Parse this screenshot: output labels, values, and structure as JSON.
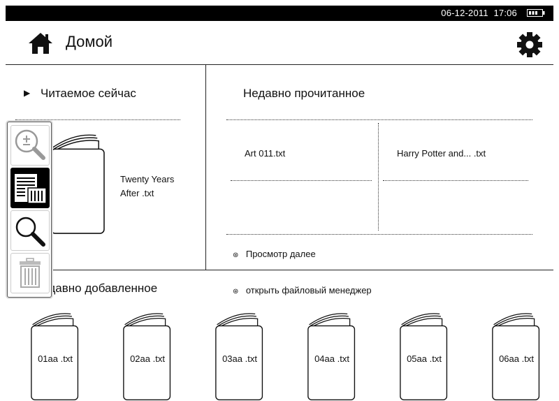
{
  "status": {
    "date": "06-12-2011",
    "time": "17:06"
  },
  "header": {
    "title": "Домой"
  },
  "reading_now": {
    "heading": "Читаемое сейчас",
    "book_line1": "Twenty Years",
    "book_line2": "After .txt"
  },
  "recent_read": {
    "heading": "Недавно прочитанное",
    "items": [
      "Art 011.txt",
      "Harry Potter and... .txt"
    ],
    "more_link": "Просмотр далее"
  },
  "recent_added": {
    "heading": "Недавно добавленное",
    "file_manager_link": "открыть файловый менеджер",
    "books": [
      "01aa .txt",
      "02aa .txt",
      "03aa .txt",
      "04aa .txt",
      "05aa .txt",
      "06aa .txt"
    ]
  },
  "toolbar": {
    "tools": [
      "zoom-in",
      "layout",
      "search",
      "delete"
    ]
  }
}
